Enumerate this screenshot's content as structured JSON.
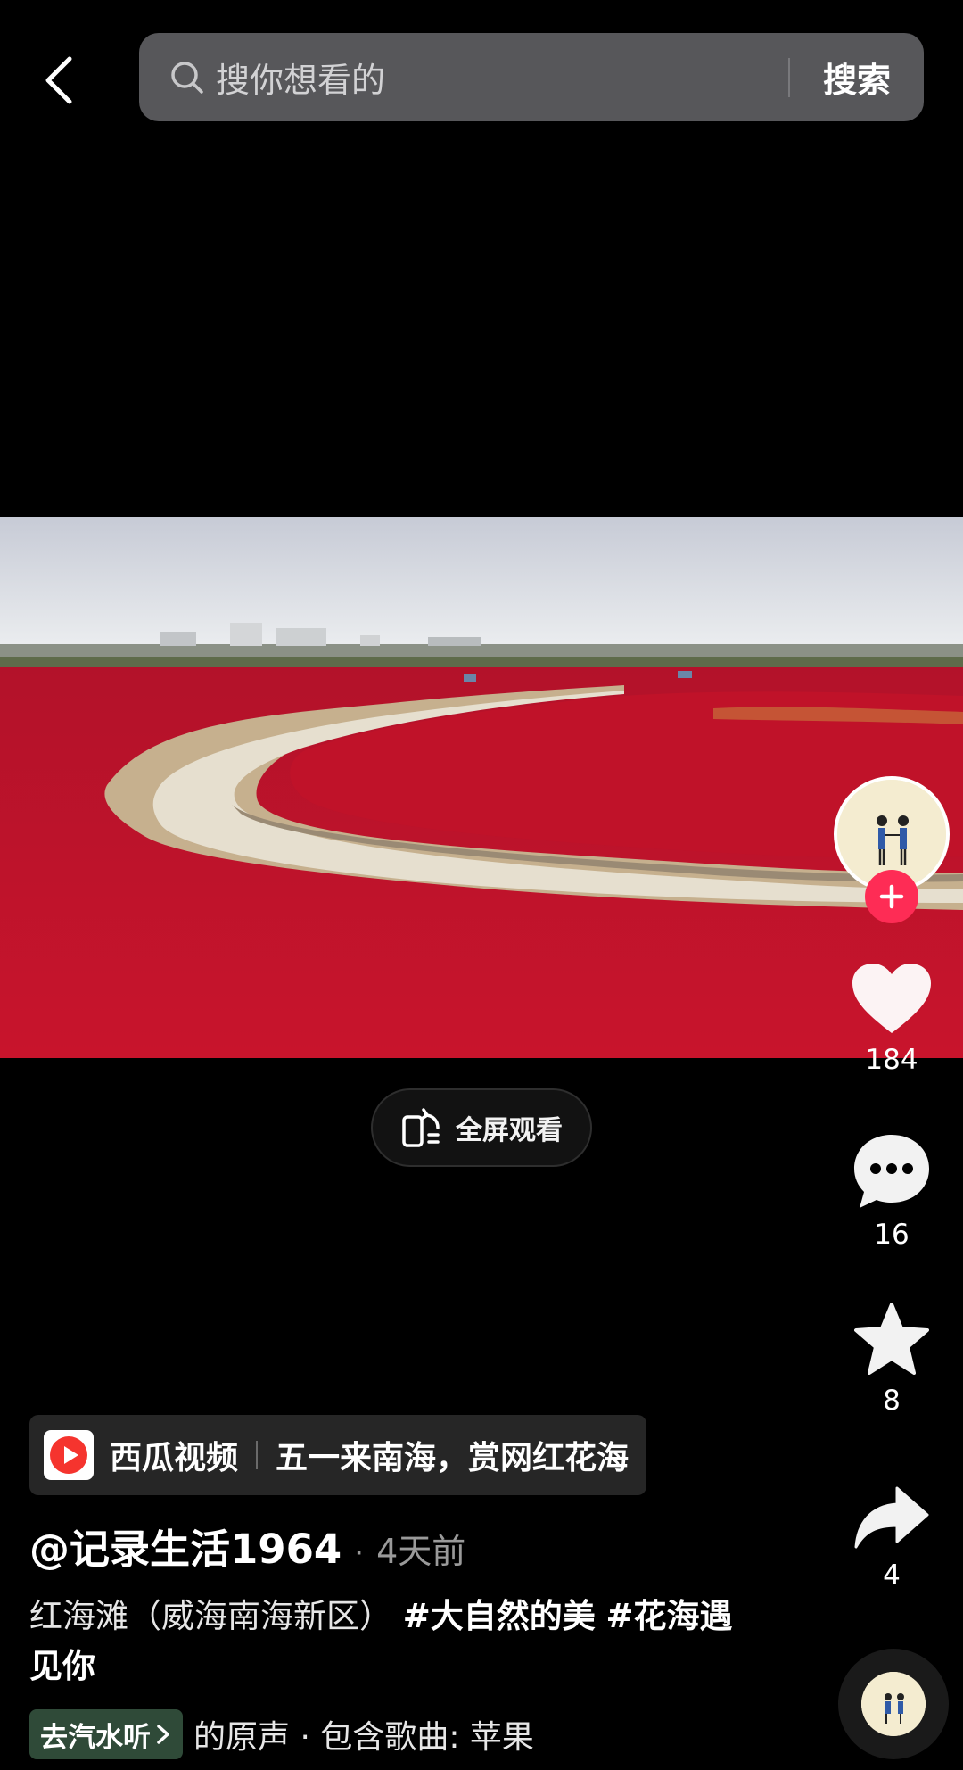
{
  "search": {
    "placeholder": "搜你想看的",
    "submit_label": "搜索"
  },
  "player": {
    "fullscreen_label": "全屏观看"
  },
  "actions": {
    "like_count": "184",
    "comment_count": "16",
    "favorite_count": "8",
    "share_count": "4"
  },
  "source": {
    "app_name": "西瓜视频",
    "title": "五一来南海，赏网红花海"
  },
  "post": {
    "author": "@记录生活1964",
    "separator": "·",
    "time": "4天前",
    "desc_text": "红海滩（威海南海新区）",
    "hashtag_1": "#大自然的美",
    "hashtag_2": "#花海遇见你"
  },
  "music": {
    "button_label": "去汽水听",
    "text": "的原声 · 包含歌曲: 苹果"
  },
  "colors": {
    "accent": "#fe2c55",
    "search_bg": "#57575a",
    "music_btn_bg": "#2f4a38"
  },
  "icons": [
    "back-arrow-icon",
    "search-icon",
    "rotate-fullscreen-icon",
    "heart-icon",
    "comment-icon",
    "star-icon",
    "share-icon",
    "plus-icon",
    "xigua-logo-icon",
    "chevron-right-icon"
  ]
}
